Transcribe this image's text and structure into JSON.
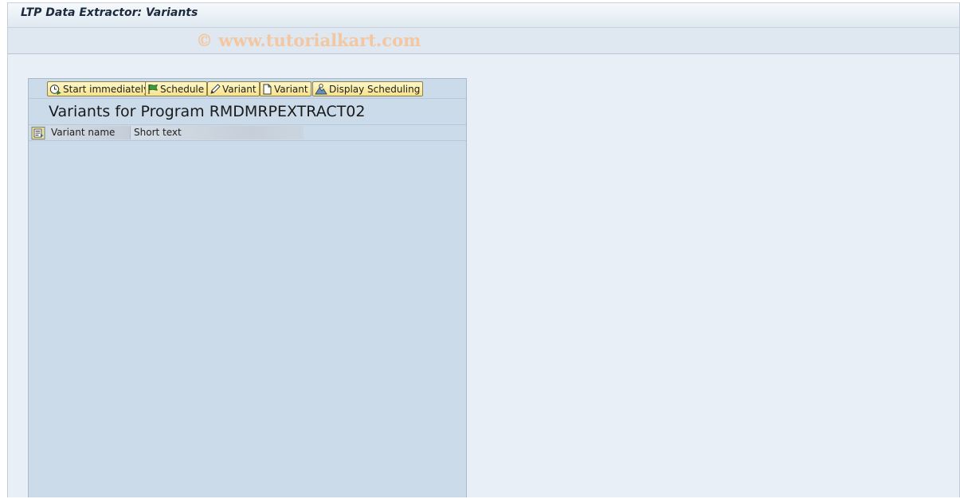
{
  "window": {
    "title": "LTP Data Extractor: Variants",
    "watermark": "© www.tutorialkart.com"
  },
  "toolbar": {
    "buttons": [
      {
        "label": "Start immediately",
        "icon": "clock-execute-icon"
      },
      {
        "label": "Schedule",
        "icon": "flag-icon"
      },
      {
        "label": "Variant",
        "icon": "pencil-icon"
      },
      {
        "label": "Variant",
        "icon": "new-document-icon"
      },
      {
        "label": "Display Scheduling",
        "icon": "mountain-icon"
      }
    ]
  },
  "panel": {
    "title": "Variants for Program RMDMRPEXTRACT02",
    "columns": [
      "Variant name",
      "Short text"
    ]
  },
  "colors": {
    "button_bg": "#f7e38a",
    "panel_bg": "#cbdbea",
    "window_bg": "#e8eff7",
    "watermark": "#f2c7a2"
  }
}
